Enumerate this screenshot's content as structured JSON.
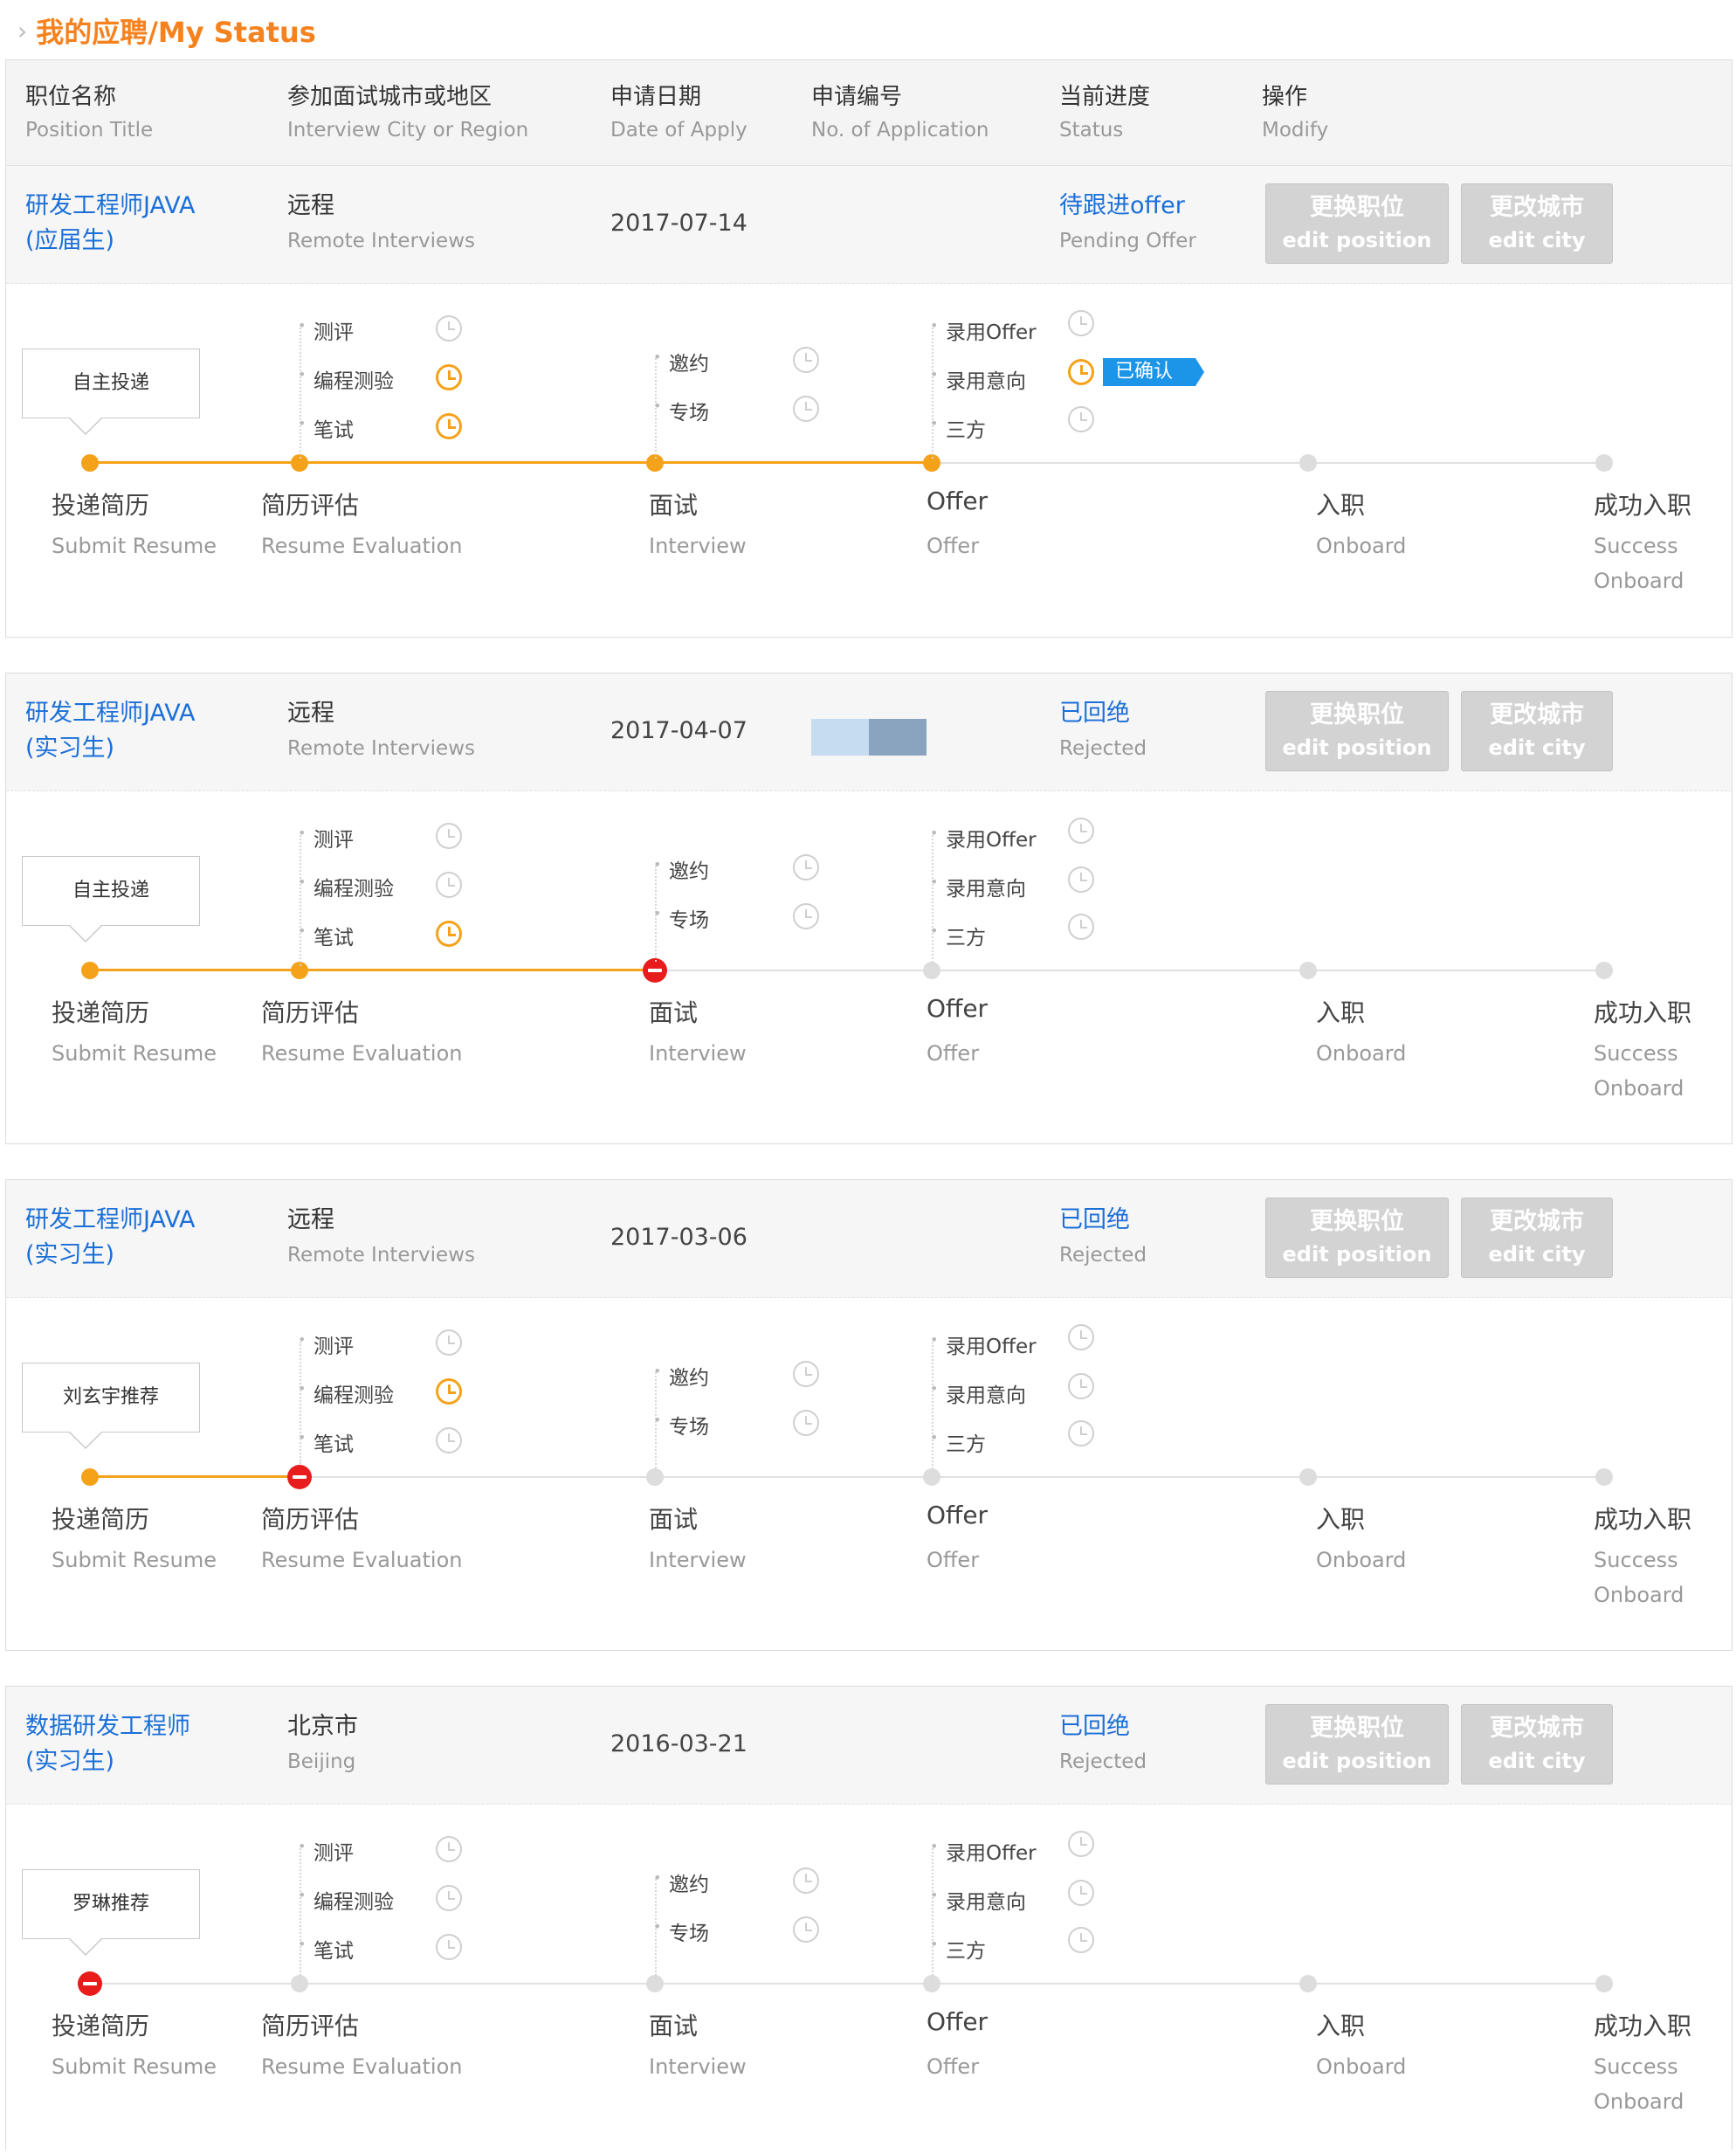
{
  "page": {
    "title": "我的应聘/My Status"
  },
  "header": [
    {
      "zh": "职位名称",
      "en": "Position Title"
    },
    {
      "zh": "参加面试城市或地区",
      "en": "Interview City or Region"
    },
    {
      "zh": "申请日期",
      "en": "Date of Apply"
    },
    {
      "zh": "申请编号",
      "en": "No. of Application"
    },
    {
      "zh": "当前进度",
      "en": "Status"
    },
    {
      "zh": "操作",
      "en": "Modify"
    }
  ],
  "buttons": {
    "edit_position": {
      "zh": "更换职位",
      "en": "edit position"
    },
    "edit_city": {
      "zh": "更改城市",
      "en": "edit city"
    }
  },
  "steps": {
    "submit": {
      "zh": "投递简历",
      "en": "Submit Resume"
    },
    "evaluation": {
      "zh": "简历评估",
      "en": "Resume Evaluation"
    },
    "interview": {
      "zh": "面试",
      "en": "Interview"
    },
    "offer": {
      "zh": "Offer",
      "en": "Offer"
    },
    "onboard": {
      "zh": "入职",
      "en": "Onboard"
    },
    "success": {
      "zh": "成功入职",
      "en1": "Success",
      "en2": "Onboard"
    }
  },
  "substeps": {
    "evaluation": [
      "测评",
      "编程测验",
      "笔试"
    ],
    "interview": [
      "邀约",
      "专场"
    ],
    "offer": [
      "录用Offer",
      "录用意向",
      "三方"
    ]
  },
  "colors": {
    "accent": "#f5a21b",
    "link": "#1a6fd8",
    "reject": "#e81c1c",
    "confirm": "#1c95e8"
  },
  "applications": [
    {
      "title": [
        "研发工程师JAVA",
        "(应届生)"
      ],
      "city": {
        "zh": "远程",
        "en": "Remote Interviews"
      },
      "date": "2017-07-14",
      "status": {
        "zh": "待跟进offer",
        "en": "Pending Offer"
      },
      "source": "自主投递",
      "confirmed_label": "已确认"
    },
    {
      "title": [
        "研发工程师JAVA",
        "(实习生)"
      ],
      "city": {
        "zh": "远程",
        "en": "Remote Interviews"
      },
      "date": "2017-04-07",
      "status": {
        "zh": "已回绝",
        "en": "Rejected"
      },
      "source": "自主投递"
    },
    {
      "title": [
        "研发工程师JAVA",
        "(实习生)"
      ],
      "city": {
        "zh": "远程",
        "en": "Remote Interviews"
      },
      "date": "2017-03-06",
      "status": {
        "zh": "已回绝",
        "en": "Rejected"
      },
      "source": "刘玄宇推荐"
    },
    {
      "title": [
        "数据研发工程师",
        "(实习生)"
      ],
      "city": {
        "zh": "北京市",
        "en": "Beijing"
      },
      "date": "2016-03-21",
      "status": {
        "zh": "已回绝",
        "en": "Rejected"
      },
      "source": "罗琳推荐"
    }
  ]
}
